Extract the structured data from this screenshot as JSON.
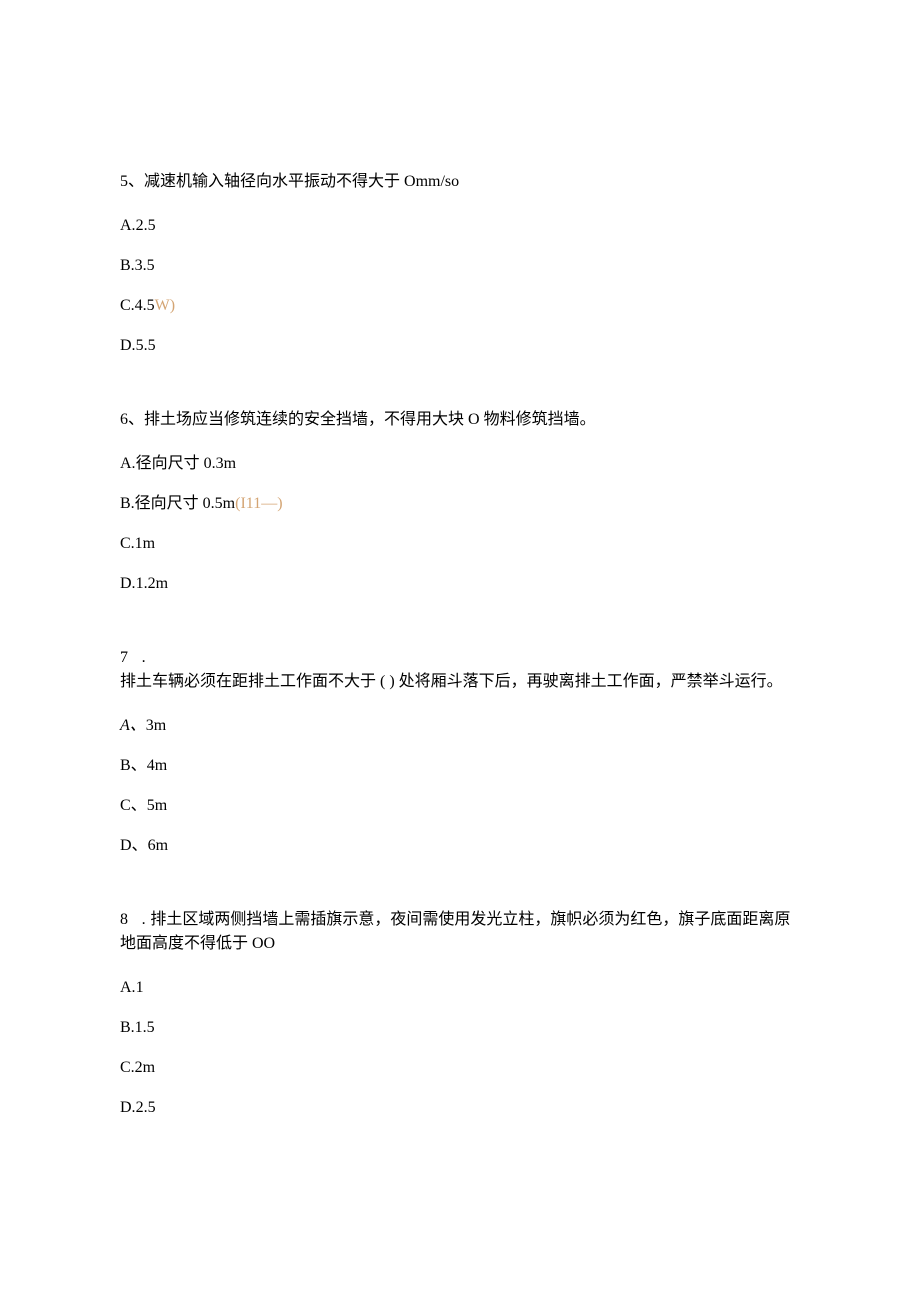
{
  "questions": [
    {
      "number": "5、",
      "text": "减速机输入轴径向水平振动不得大于 Omm/so",
      "options": [
        {
          "label": "A.",
          "value": "2.5",
          "annotation": ""
        },
        {
          "label": "B.",
          "value": "3.5",
          "annotation": ""
        },
        {
          "label": "C.",
          "value": "4.5",
          "annotation": "W)"
        },
        {
          "label": "D.",
          "value": "5.5",
          "annotation": ""
        }
      ]
    },
    {
      "number": "6、",
      "text": "排土场应当修筑连续的安全挡墙，不得用大块 O 物料修筑挡墙。",
      "options": [
        {
          "label": "A.",
          "value": "径向尺寸 0.3m",
          "annotation": ""
        },
        {
          "label": "B.",
          "value": "径向尺寸 0.5m",
          "annotation": "(I11—)"
        },
        {
          "label": "C.",
          "value": "1m",
          "annotation": ""
        },
        {
          "label": "D.",
          "value": "1.2m",
          "annotation": ""
        }
      ]
    },
    {
      "number": "7 .",
      "text": "排土车辆必须在距排土工作面不大于 ( ) 处将厢斗落下后，再驶离排土工作面，严禁举斗运行。",
      "numberOnOwnLine": true,
      "options": [
        {
          "label": "A、",
          "value": "3m",
          "annotation": "",
          "italicLabel": true
        },
        {
          "label": "B、",
          "value": "4m",
          "annotation": ""
        },
        {
          "label": "C、",
          "value": "5m",
          "annotation": ""
        },
        {
          "label": "D、",
          "value": "6m",
          "annotation": ""
        }
      ]
    },
    {
      "number": "8 .",
      "text": "排土区域两侧挡墙上需插旗示意，夜间需使用发光立柱，旗帜必须为红色，旗子底面距离原地面高度不得低于 OO",
      "options": [
        {
          "label": "A.",
          "value": "1",
          "annotation": ""
        },
        {
          "label": "B.",
          "value": "1.5",
          "annotation": ""
        },
        {
          "label": "C.",
          "value": "2m",
          "annotation": ""
        },
        {
          "label": "D.",
          "value": "2.5",
          "annotation": ""
        }
      ]
    }
  ]
}
